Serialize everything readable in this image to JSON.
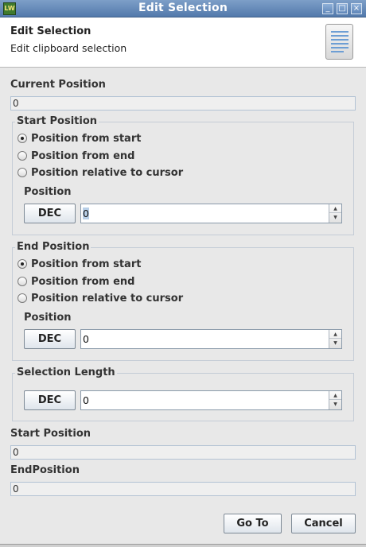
{
  "window": {
    "title": "Edit Selection",
    "icon": "app-icon",
    "controls": [
      "minimize-icon",
      "maximize-icon",
      "close-icon"
    ]
  },
  "header": {
    "title": "Edit Selection",
    "subtitle": "Edit clipboard selection",
    "icon": "document-lines-icon"
  },
  "current_position": {
    "label": "Current Position",
    "value": "0"
  },
  "start_group": {
    "title": "Start Position",
    "options": [
      "Position from start",
      "Position from end",
      "Position relative to cursor"
    ],
    "selected_index": 0,
    "position_label": "Position",
    "base_button": "DEC",
    "value": "0"
  },
  "end_group": {
    "title": "End Position",
    "options": [
      "Position from start",
      "Position from end",
      "Position relative to cursor"
    ],
    "selected_index": 0,
    "position_label": "Position",
    "base_button": "DEC",
    "value": "0"
  },
  "length_group": {
    "title": "Selection Length",
    "base_button": "DEC",
    "value": "0"
  },
  "start_readout": {
    "label": "Start Position",
    "value": "0"
  },
  "end_readout": {
    "label": "EndPosition",
    "value": "0"
  },
  "buttons": {
    "goto": "Go To",
    "cancel": "Cancel"
  }
}
